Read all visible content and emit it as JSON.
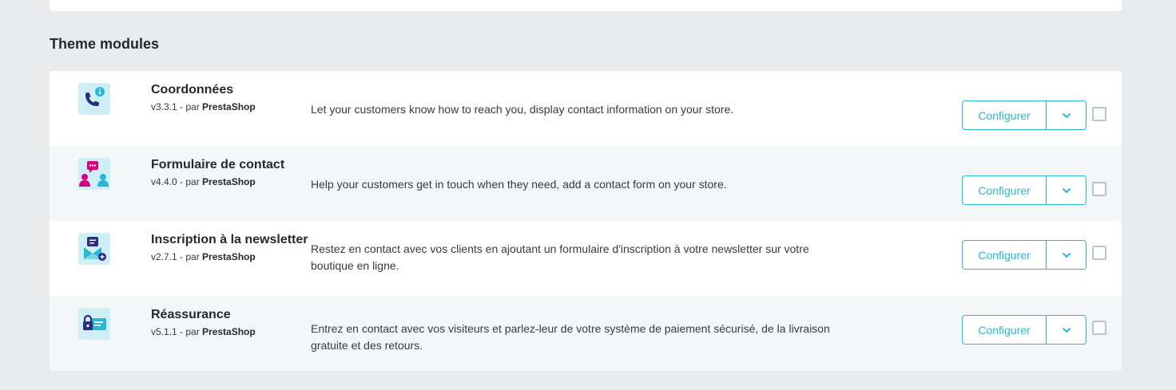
{
  "section": {
    "title": "Theme modules"
  },
  "modules": [
    {
      "name": "Coordonnées",
      "version": "v3.3.1 - par ",
      "author": "PrestaShop",
      "description": "Let your customers know how to reach you, display contact information on your store.",
      "configure_label": "Configurer",
      "icon": "phone-info-icon"
    },
    {
      "name": "Formulaire de contact",
      "version": "v4.4.0 - par ",
      "author": "PrestaShop",
      "description": "Help your customers get in touch when they need, add a contact form on your store.",
      "configure_label": "Configurer",
      "icon": "contact-people-icon"
    },
    {
      "name": "Inscription à la newsletter",
      "version": "v2.7.1 - par ",
      "author": "PrestaShop",
      "description": "Restez en contact avec vos clients en ajoutant un formulaire d'inscription à votre newsletter sur votre boutique en ligne.",
      "configure_label": "Configurer",
      "icon": "newsletter-icon"
    },
    {
      "name": "Réassurance",
      "version": "v5.1.1 - par ",
      "author": "PrestaShop",
      "description": "Entrez en contact avec vos visiteurs et parlez-leur de votre système de paiement sécurisé, de la livraison gratuite et des retours.",
      "configure_label": "Configurer",
      "icon": "lock-card-icon"
    }
  ],
  "colors": {
    "accent": "#25b9d7",
    "icon_bg": "#cfeef5",
    "navy": "#2b2e7e",
    "magenta": "#d5007f"
  }
}
